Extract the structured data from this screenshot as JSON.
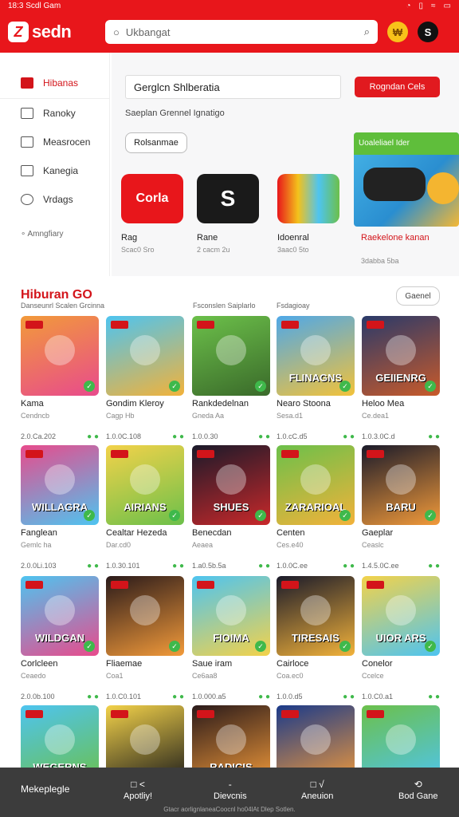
{
  "status": {
    "time": "18:3 Scdl",
    "carrier": "Gam",
    "icons": [
      "notification-icon",
      "sim-icon",
      "wifi-icon",
      "battery-icon"
    ]
  },
  "header": {
    "brand": "sedn",
    "brand_mark": "Z",
    "search_placeholder": "Ukbangat",
    "coin": "₩",
    "user": "S"
  },
  "sidebar": {
    "items": [
      {
        "label": "Hibanas",
        "icon": "store-icon",
        "active": true
      },
      {
        "label": "Ranoky",
        "icon": "folder-icon"
      },
      {
        "label": "Measrocen",
        "icon": "list-icon"
      },
      {
        "label": "Kanegia",
        "icon": "bookmark-icon"
      },
      {
        "label": "Vrdags",
        "icon": "person-icon"
      }
    ],
    "footer": "Amngfiary"
  },
  "featured": {
    "category_value": "Gerglcn Shlberatia",
    "category_button": "Rogndan Cels",
    "subtitle": "Saeplan Grennel Ignatigo",
    "filter_pill": "Rolsanmae",
    "apps": [
      {
        "name": "Rag",
        "meta": "Scac0 Sro",
        "icon_text": "Corla",
        "color": "#e8161b"
      },
      {
        "name": "Rane",
        "meta": "2 cacm 2u",
        "icon_text": "S",
        "color": "#1a1a1a"
      },
      {
        "name": "Idoenral",
        "meta": "3aac0 5to",
        "icon_text": "",
        "color": "#f3c21b"
      }
    ],
    "promo": {
      "label": "Uoaleliael Ider",
      "title": "Raekelone kanan",
      "meta": "3dabba 5ba"
    }
  },
  "section": {
    "title": "Hiburan GO",
    "sub_1": "Danseunrl Scalen Grcinna",
    "sub_2": "Fsconslen Saiplarlo",
    "sub_3": "Fsdagioay",
    "see_all": "Gaenel"
  },
  "games": [
    {
      "name": "Kama",
      "sub": "Cendncb",
      "price": "2.0.Ca.202",
      "title": "",
      "colors": [
        "#f29a3a",
        "#e84b8c"
      ]
    },
    {
      "name": "Gondim Kleroy",
      "sub": "Cagp Hb",
      "price": "1.0.0C.108",
      "title": "",
      "colors": [
        "#4ec4f0",
        "#f2b23a"
      ]
    },
    {
      "name": "Rankdedelnan",
      "sub": "Gneda Aa",
      "price": "1.0.0.30",
      "title": "",
      "colors": [
        "#6cc04a",
        "#3a6a2a"
      ]
    },
    {
      "name": "Nearo Stoona",
      "sub": "Sesa.d1",
      "price": "1.0.cC.d5",
      "title": "FLINAGNS",
      "colors": [
        "#4fa8e8",
        "#f2c23a"
      ]
    },
    {
      "name": "Heloo Mea",
      "sub": "Ce.dea1",
      "price": "1.0.3.0C.d",
      "title": "GEIIENRG",
      "colors": [
        "#2a3a6a",
        "#c85a2a"
      ]
    },
    {
      "name": "Fanglean",
      "sub": "Gemlc ha",
      "price": "2.0.0Li.103",
      "title": "WILLAGRA",
      "colors": [
        "#e84b8c",
        "#4ec4f0"
      ]
    },
    {
      "name": "Cealtar Hezeda",
      "sub": "Dar.cd0",
      "price": "1.0.30.101",
      "title": "AIRIANS",
      "colors": [
        "#f3d24a",
        "#6cc04a"
      ]
    },
    {
      "name": "Benecdan",
      "sub": "Aeaea",
      "price": "1.a0.5b.5a",
      "title": "SHUES",
      "colors": [
        "#1a1a2a",
        "#c8282a"
      ]
    },
    {
      "name": "Centen",
      "sub": "Ces.e40",
      "price": "1.0.0C.ee",
      "title": "ZARARIOAL",
      "colors": [
        "#6cc04a",
        "#f2b23a"
      ]
    },
    {
      "name": "Gaeplar",
      "sub": "Ceaslc",
      "price": "1.4.5.0C.ee",
      "title": "BARU",
      "colors": [
        "#1a1a2a",
        "#f29a3a"
      ]
    },
    {
      "name": "Corlcleen",
      "sub": "Ceaedo",
      "price": "2.0.0b.100",
      "title": "WILDGAN",
      "colors": [
        "#4ec4f0",
        "#e84b8c"
      ]
    },
    {
      "name": "Fliaemae",
      "sub": "Coa1",
      "price": "1.0.C0.101",
      "title": "",
      "colors": [
        "#2a1a1a",
        "#f29a3a"
      ]
    },
    {
      "name": "Saue iram",
      "sub": "Ce6aa8",
      "price": "1.0.000.a5",
      "title": "FIOIMA",
      "colors": [
        "#4ec4f0",
        "#f3d24a"
      ]
    },
    {
      "name": "Cairloce",
      "sub": "Coa.ec0",
      "price": "1.0.0.d5",
      "title": "TIRESAIS",
      "colors": [
        "#1a1a2a",
        "#f2b23a"
      ]
    },
    {
      "name": "Conelor",
      "sub": "Ccelce",
      "price": "1.0.C0.a1",
      "title": "UIOR ARS",
      "colors": [
        "#f3d24a",
        "#4ec4f0"
      ]
    },
    {
      "name": "",
      "sub": "",
      "price": "",
      "title": "WEGERNS",
      "colors": [
        "#4ec4f0",
        "#6cc04a"
      ]
    },
    {
      "name": "",
      "sub": "",
      "price": "",
      "title": "",
      "colors": [
        "#f3d24a",
        "#1a1a1a"
      ]
    },
    {
      "name": "",
      "sub": "",
      "price": "",
      "title": "RADICIS",
      "colors": [
        "#2a1a1a",
        "#f29a3a"
      ]
    },
    {
      "name": "",
      "sub": "",
      "price": "",
      "title": "",
      "colors": [
        "#1a3a8a",
        "#f29a3a"
      ]
    },
    {
      "name": "",
      "sub": "",
      "price": "",
      "title": "",
      "colors": [
        "#6cc04a",
        "#4ec4f0"
      ]
    }
  ],
  "bottom_nav": {
    "items": [
      {
        "label": "Mekeplegle",
        "icon": ""
      },
      {
        "label": "Apotliy!",
        "icon": "□ <"
      },
      {
        "label": "Dievcnis",
        "icon": "-"
      },
      {
        "label": "Aneuion",
        "icon": "□ √"
      },
      {
        "label": "Bod Gane",
        "icon": "⟲"
      }
    ],
    "footer": "Gtacr aorlignlaneaCoocnl ho04lAt Dlep Sotlen."
  }
}
